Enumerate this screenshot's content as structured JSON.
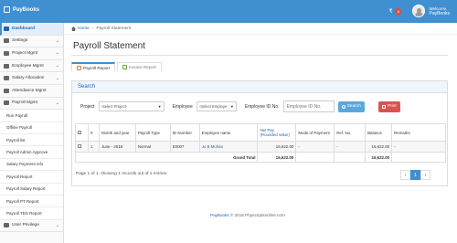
{
  "app": {
    "brand": "PayBooks",
    "currency_symbol": "₹",
    "notification_count": "6",
    "welcome": "Welcome,",
    "user_name": "PayBooks"
  },
  "sidebar": {
    "items": [
      {
        "label": "Dashboard",
        "icon": "dashboard-icon",
        "active": true
      },
      {
        "label": "Settings",
        "icon": "gear-icon",
        "chevron": true
      },
      {
        "label": "Project Mgmt",
        "icon": "project-icon",
        "chevron": true
      },
      {
        "label": "Employee Mgmt",
        "icon": "users-icon",
        "chevron": true
      },
      {
        "label": "Salary Allocation",
        "icon": "money-icon",
        "chevron": true
      },
      {
        "label": "Attendance Mgmt",
        "icon": "calendar-icon"
      },
      {
        "label": "Payroll Mgmt",
        "icon": "payroll-icon",
        "chevron": true
      }
    ],
    "subitems": [
      "Run Payroll",
      "Offline Payroll",
      "Payroll list",
      "Payroll Admin Approve",
      "Salary Payment info",
      "Payroll Report",
      "Payroll Salary Report",
      "Payroll PT Report",
      "Payroll TDS Report"
    ],
    "last_item": {
      "label": "User Privilege",
      "icon": "user-lock-icon",
      "chevron": true
    }
  },
  "breadcrumb": {
    "home": "Home",
    "current": "Payroll Statement"
  },
  "page": {
    "title": "Payroll Statement"
  },
  "tabs": [
    {
      "label": "Payroll Report",
      "active": true
    },
    {
      "label": "Invoice Report",
      "active": false
    }
  ],
  "search": {
    "heading": "Search",
    "project_label": "Project",
    "project_value": "-Select Project-",
    "employee_label": "Employee",
    "employee_value": "-Select Employe",
    "empid_label": "Employee ID No.",
    "empid_placeholder": "Employee ID No.",
    "search_button": "Search",
    "print_button": "Print"
  },
  "table": {
    "headers": [
      "#",
      "Month and year",
      "Payroll Type",
      "ID Number",
      "Employee name",
      "Net Pay (Rounded value)",
      "Mode of Payment",
      "Ref. No.",
      "Balance",
      "Remarks"
    ],
    "net_pay_main": "Net Pay",
    "net_pay_sub": "(Rounded value)",
    "rows": [
      {
        "num": "1",
        "month": "June - 2018",
        "type": "Normal",
        "id": "E0007",
        "name": "Jo B Mohan",
        "net": "16,622.00",
        "mode": "-",
        "ref": "-",
        "balance": "16,622.00",
        "remarks": "-"
      }
    ],
    "total": {
      "label": "Grand Total",
      "net": "16,622.00",
      "balance": "16,622.00"
    }
  },
  "pagination": {
    "info": "Page 1 of 1, showing 1 records out of 1 entries",
    "prev": "‹",
    "current": "1",
    "next": "›"
  },
  "footer": {
    "brand": "PayBooks",
    "text": " © 2018 Phpscriptsonline.com"
  }
}
